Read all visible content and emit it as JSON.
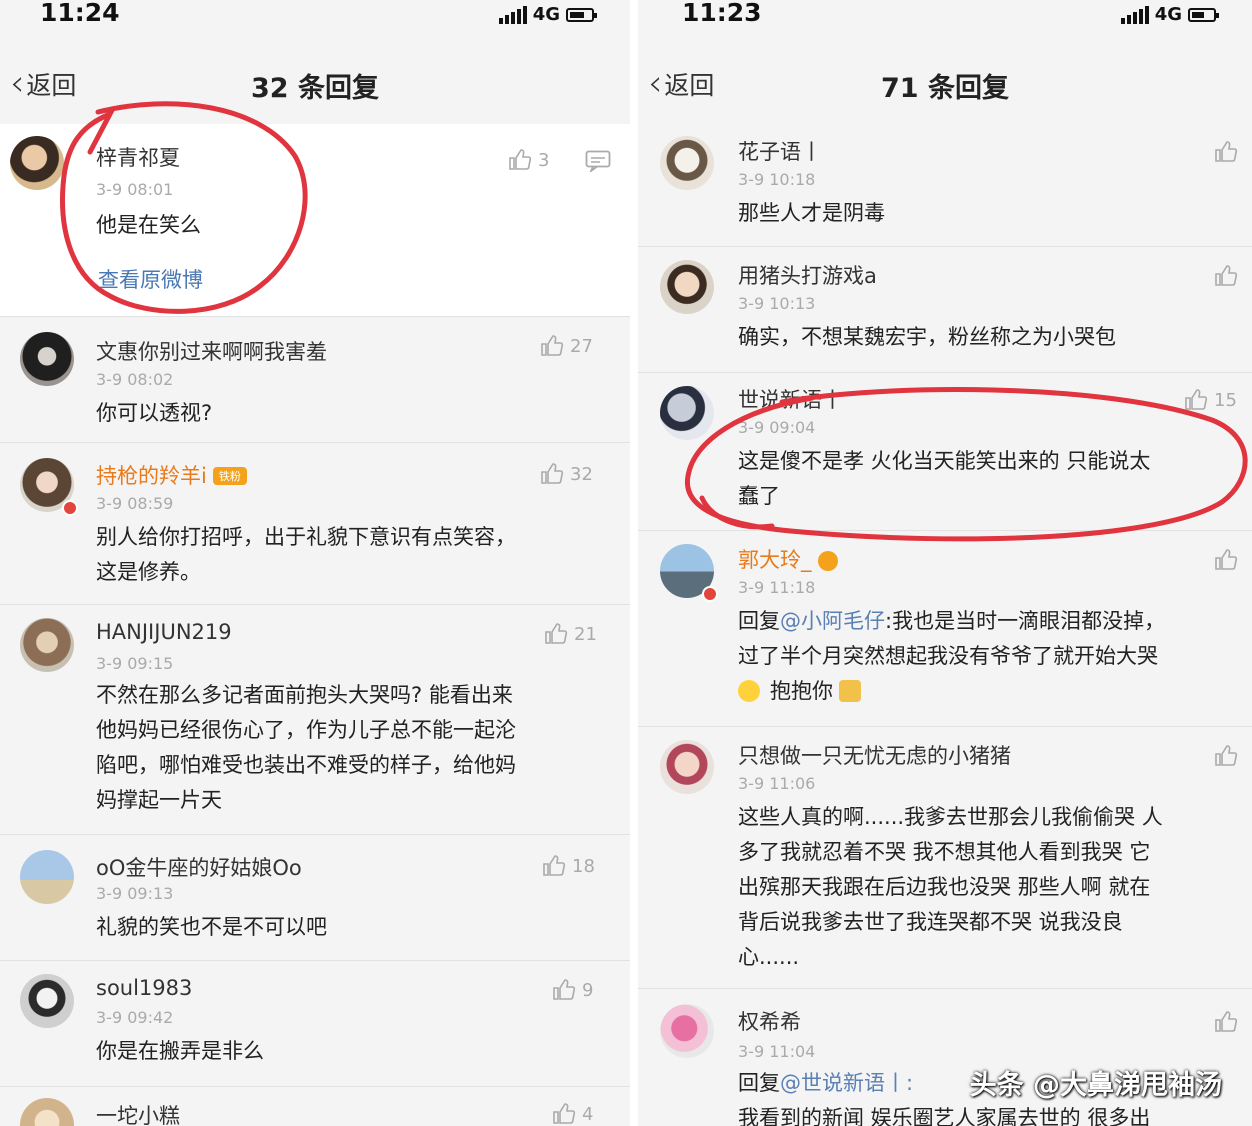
{
  "left": {
    "time": "11:24",
    "network": "4G",
    "back_label": "返回",
    "title": "32 条回复",
    "comments": [
      {
        "user": "梓青祁夏",
        "time": "3-9 08:01",
        "text": "他是在笑么",
        "likes": "3",
        "link": "查看原微博"
      },
      {
        "user": "文惠你别过来啊啊我害羞",
        "time": "3-9 08:02",
        "text": "你可以透视?",
        "likes": "27"
      },
      {
        "user": "持枪的羚羊i",
        "badge": "铁粉",
        "time": "3-9 08:59",
        "text_lines": [
          "别人给你打招呼，出于礼貌下意识有点笑容，",
          "这是修养。"
        ],
        "likes": "32"
      },
      {
        "user": "HANJIJUN219",
        "time": "3-9 09:15",
        "text_lines": [
          "不然在那么多记者面前抱头大哭吗? 能看出来",
          "他妈妈已经很伤心了，作为儿子总不能一起沦",
          "陷吧，哪怕难受也装出不难受的样子，给他妈",
          "妈撑起一片天"
        ],
        "likes": "21"
      },
      {
        "user": "oO金牛座的好姑娘Oo",
        "time": "3-9 09:13",
        "text": "礼貌的笑也不是不可以吧",
        "likes": "18"
      },
      {
        "user": "soul1983",
        "time": "3-9 09:42",
        "text": "你是在搬弄是非么",
        "likes": "9"
      },
      {
        "user": "一坨小糕",
        "likes": "4"
      }
    ]
  },
  "right": {
    "time": "11:23",
    "network": "4G",
    "back_label": "返回",
    "title": "71 条回复",
    "comments": [
      {
        "user": "花子语丨",
        "time": "3-9 10:18",
        "text": "那些人才是阴毒"
      },
      {
        "user": "用猪头打游戏a",
        "time": "3-9 10:13",
        "text": "确实，不想某魏宏宇，粉丝称之为小哭包"
      },
      {
        "user": "世说新语丨",
        "time": "3-9 09:04",
        "text_lines": [
          "这是傻不是孝 火化当天能笑出来的 只能说太",
          "蠢了"
        ],
        "likes": "15"
      },
      {
        "user": "郭大玲_",
        "time": "3-9 11:18",
        "reply_prefix": "回复",
        "mention": "@小阿毛仔",
        "text_lines": [
          "我也是当时一滴眼泪都没掉，",
          "过了半个月突然想起我没有爷爷了就开始大哭",
          "抱抱你"
        ]
      },
      {
        "user": "只想做一只无忧无虑的小猪猪",
        "time": "3-9 11:06",
        "text_lines": [
          "这些人真的啊......我爹去世那会儿我偷偷哭 人",
          "多了我就忍着不哭 我不想其他人看到我哭 它",
          "出殡那天我跟在后边我也没哭 那些人啊 就在",
          "背后说我爹去世了我连哭都不哭 说我没良",
          "心......"
        ]
      },
      {
        "user": "权希希",
        "time": "3-9 11:04",
        "reply_prefix": "回复",
        "mention": "@世说新语丨:",
        "text_lines": [
          "",
          "我看到的新闻 娱乐圈艺人家属去世的 很多出"
        ]
      }
    ]
  },
  "watermark": "头条 @大鼻涕甩袖汤",
  "colors": {
    "highlight_circle": "#e0343f",
    "link": "#4a78b4",
    "vip_name": "#e87a1c"
  }
}
